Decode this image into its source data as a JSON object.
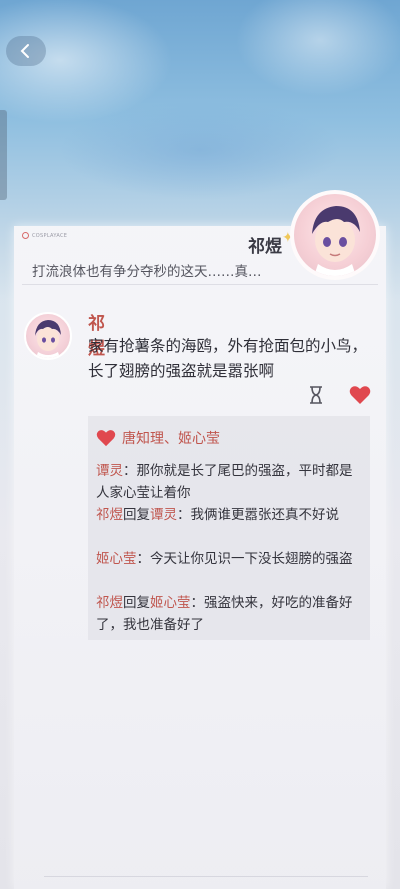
{
  "header": {
    "brand_text": "COSPLAYACE",
    "name": "祁煜",
    "status": "打流浪体也有争分夺秒的这天……真…"
  },
  "post": {
    "author": "祁煜",
    "text": "家有抢薯条的海鸥，外有抢面包的小鸟，长了翅膀的强盗就是嚣张啊"
  },
  "likes": {
    "names": "唐知理、姬心莹"
  },
  "comments": [
    {
      "user": "谭灵",
      "sep": "：",
      "text": "那你就是长了尾巴的强盗，平时都是人家心莹让着你"
    },
    {
      "user": "祁煜",
      "reply_word": "回复",
      "target": "谭灵",
      "sep": "：",
      "text": "我俩谁更嚣张还真不好说"
    },
    {
      "user": "姬心莹",
      "sep": "：",
      "text": "今天让你见识一下没长翅膀的强盗"
    },
    {
      "user": "祁煜",
      "reply_word": "回复",
      "target": "姬心莹",
      "sep": "：",
      "text": "强盗快来，好吃的准备好了，我也准备好了"
    }
  ],
  "colors": {
    "accent": "#c0564e",
    "heart": "#e0484f"
  },
  "icons": {
    "back": "chevron-left-icon",
    "hourglass": "hourglass-icon",
    "heart": "heart-icon"
  }
}
